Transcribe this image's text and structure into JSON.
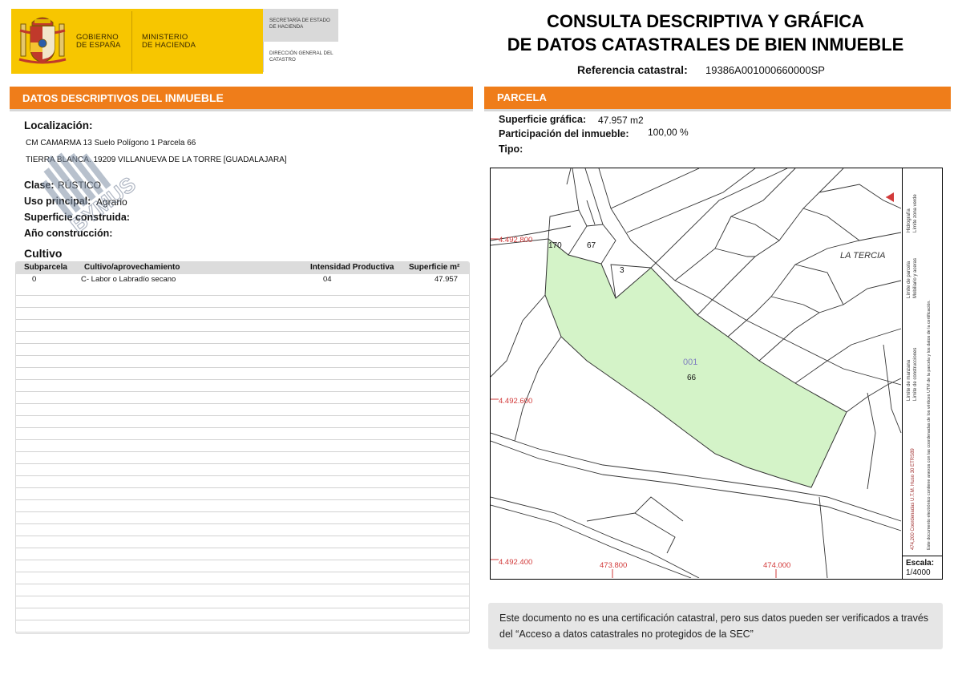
{
  "logo": {
    "gobierno": "GOBIERNO DE ESPAÑA",
    "ministerio": "MINISTERIO DE HACIENDA",
    "secretaria": "SECRETARÍA DE ESTADO DE HACIENDA",
    "direccion": "DIRECCIÓN GENERAL DEL CATASTRO",
    "brand_yellow": "#f7c600"
  },
  "title": {
    "line1": "CONSULTA DESCRIPTIVA Y GRÁFICA",
    "line2": "DE DATOS CATASTRALES DE BIEN INMUEBLE",
    "refcat_label": "Referencia catastral:",
    "refcat_value": "19386A001000660000SP"
  },
  "left": {
    "header_prefix": "DATOS DESCRIPTIVOS DEL",
    "header_bold": "INMUEBLE",
    "localizacion_label": "Localización:",
    "localizacion_line1": "CM CAMARMA 13 Suelo Polígono 1 Parcela 66",
    "localizacion_line2": "TIERRA BLANCA. 19209 VILLANUEVA DE LA TORRE [GUADALAJARA]",
    "clase_label": "Clase:",
    "clase_value": "RÚSTICO",
    "uso_label": "Uso principal:",
    "uso_value": "Agrario",
    "superficie_label": "Superficie construida:",
    "anio_label": "Año construcción:",
    "cultivo_title": "Cultivo",
    "table_headers": [
      "Subparcela",
      "Cultivo/aprovechamiento",
      "Intensidad Productiva",
      "Superficie m²"
    ],
    "table_rows": [
      [
        "0",
        "C- Labor o Labradío secano",
        "04",
        "47.957"
      ]
    ]
  },
  "right": {
    "header": "PARCELA",
    "sup_grafica_label": "Superficie gráfica:",
    "sup_grafica_value": "47.957 m2",
    "participacion_label": "Participación del inmueble:",
    "participacion_value": "100,00 %",
    "tipo_label": "Tipo:",
    "escala_label": "Escala:",
    "escala_value": "1/4000"
  },
  "map": {
    "parcel_color": "#d4f3c8",
    "coord_color": "#d23a3a",
    "coords_y": [
      "4.492.800",
      "4.492.600",
      "4.492.400"
    ],
    "coords_x": [
      "473.800",
      "474.000"
    ],
    "parcel_labels": [
      "170",
      "67",
      "3"
    ],
    "subparcel_id": "001",
    "parcel_number": "66",
    "place_name": "LA TERCIA",
    "legend": {
      "hidrografia": "Hidrografía",
      "zona_verde": "Límite zona verde",
      "limite_parcela": "Límite de parcela",
      "mobiliario": "Mobiliario y aceras",
      "limite_manzana": "Límite de manzana",
      "limite_construcciones": "Límite de construcciones",
      "coordenadas": "474,200 Coordenadas U.T.M. Huso 30 ETRS89",
      "nota": "Este documento electrónico contiene anexos con las coordenadas de los vértices UTM de la parcela y los datos de la certificación."
    }
  },
  "disclaimer": "Este documento no es una certificación catastral, pero sus datos pueden ser verificados a través del “Acceso a datos catastrales no protegidos de la SEC”",
  "watermark": "BYMUS"
}
